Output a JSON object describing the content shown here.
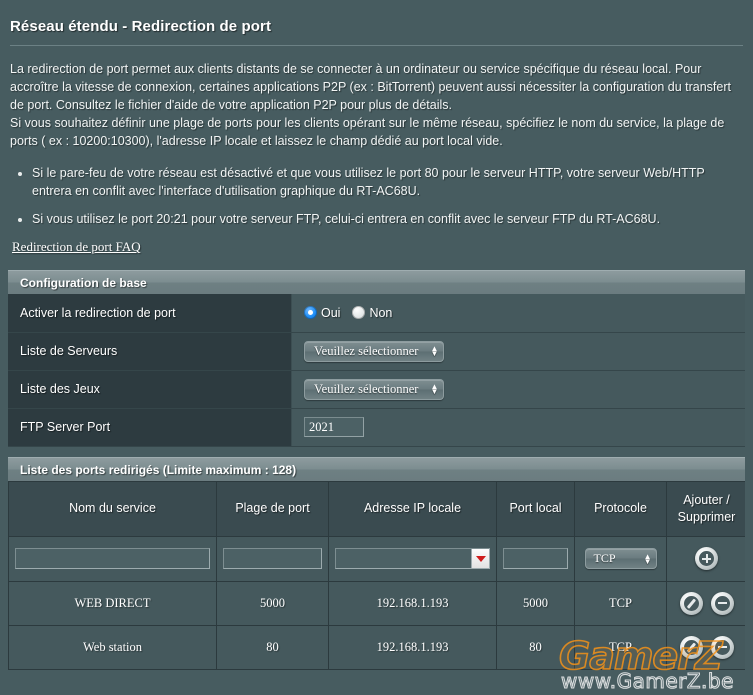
{
  "page": {
    "title": "Réseau étendu - Redirection de port",
    "description": [
      "La redirection de port permet aux clients distants de se connecter à un ordinateur ou service spécifique du réseau local. Pour accroître la vitesse de connexion, certaines applications P2P (ex : BitTorrent) peuvent aussi nécessiter la configuration du transfert de port. Consultez le fichier d'aide de votre application P2P pour plus de détails.",
      "Si vous souhaitez définir une plage de ports pour les clients opérant sur le même réseau, spécifiez le nom du service, la plage de ports ( ex : 10200:10300), l'adresse IP locale et laissez le champ dédié au port local vide."
    ],
    "notes": [
      "Si le pare-feu de votre réseau est désactivé et que vous utilisez le port 80 pour le serveur HTTP, votre serveur Web/HTTP entrera en conflit avec l'interface d'utilisation graphique du RT-AC68U.",
      "Si vous utilisez le port 20:21 pour votre serveur FTP, celui-ci entrera en conflit avec le serveur FTP du RT-AC68U."
    ],
    "faq_link": "Redirection de port FAQ"
  },
  "basic_config": {
    "header": "Configuration de base",
    "rows": {
      "enable": {
        "label": "Activer la redirection de port",
        "yes_label": "Oui",
        "no_label": "Non",
        "selected": "Oui"
      },
      "server_list": {
        "label": "Liste de Serveurs",
        "value": "Veuillez sélectionner"
      },
      "game_list": {
        "label": "Liste des Jeux",
        "value": "Veuillez sélectionner"
      },
      "ftp_port": {
        "label": "FTP Server Port",
        "value": "2021"
      }
    }
  },
  "port_list": {
    "header": "Liste des ports redirigés (Limite maximum : 128)",
    "columns": [
      "Nom du service",
      "Plage de port",
      "Adresse IP locale",
      "Port local",
      "Protocole",
      "Ajouter / Supprimer"
    ],
    "columns_split": {
      "action_line1": "Ajouter /",
      "action_line2": "Supprimer"
    },
    "input_row": {
      "service_name": "",
      "port_range": "",
      "local_ip": "",
      "local_port": "",
      "protocol": "TCP",
      "add_icon": "plus-circle-icon"
    },
    "rows": [
      {
        "service_name": "WEB DIRECT",
        "port_range": "5000",
        "local_ip": "192.168.1.193",
        "local_port": "5000",
        "protocol": "TCP"
      },
      {
        "service_name": "Web station",
        "port_range": "80",
        "local_ip": "192.168.1.193",
        "local_port": "80",
        "protocol": "TCP"
      }
    ]
  },
  "watermark": {
    "main": "GamerZ",
    "sub": "www.GamerZ.be"
  },
  "colors": {
    "page_bg": "#475c60",
    "label_bg": "#2d3b40",
    "field_bg": "#45595d",
    "section_bar": "#6e8083",
    "accent_radio": "#1f8ef5",
    "dropdown_arrow_red": "#cf1d1d",
    "watermark_orange": "#f3920f"
  }
}
